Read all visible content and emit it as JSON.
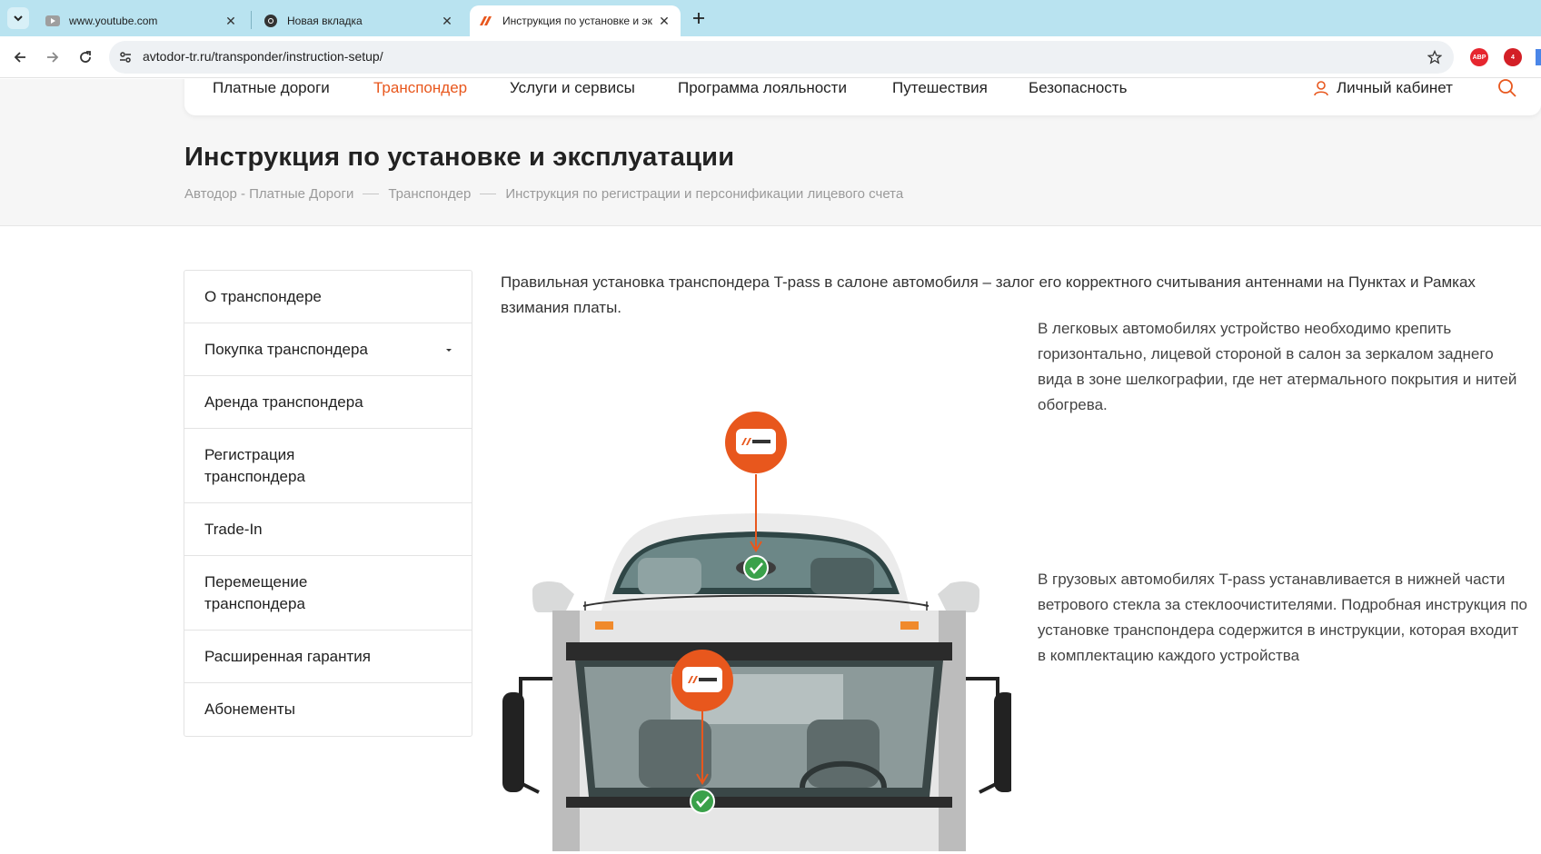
{
  "browser": {
    "tabs": [
      {
        "title": "www.youtube.com",
        "icon": "youtube-icon",
        "active": false
      },
      {
        "title": "Новая вкладка",
        "icon": "chrome-icon",
        "active": false
      },
      {
        "title": "Инструкция по установке и эк",
        "icon": "avtodor-logo-icon",
        "active": true
      }
    ],
    "url": "avtodor-tr.ru/transponder/instruction-setup/",
    "extensions": [
      {
        "name": "adblock-plus-icon",
        "label": "ABP",
        "color": "#e6262f"
      },
      {
        "name": "extension-badge-icon",
        "label": "4",
        "color": "#d31f26"
      }
    ]
  },
  "site": {
    "nav": [
      {
        "label": "Платные дороги",
        "active": false
      },
      {
        "label": "Транспондер",
        "active": true
      },
      {
        "label": "Услуги и сервисы",
        "active": false
      },
      {
        "label": "Программа лояльности",
        "active": false
      },
      {
        "label": "Путешествия",
        "active": false
      },
      {
        "label": "Безопасность",
        "active": false
      }
    ],
    "cabinet_label": "Личный кабинет",
    "accent_color": "#e8571d",
    "page_title": "Инструкция по установке и эксплуатации",
    "breadcrumbs": [
      "Автодор - Платные Дороги",
      "Транспондер",
      "Инструкция по регистрации и персонификации лицевого счета"
    ],
    "side_menu": [
      {
        "label": "О транспондере",
        "has_submenu": false
      },
      {
        "label": "Покупка транспондера",
        "has_submenu": true
      },
      {
        "label": "Аренда транспондера",
        "has_submenu": false
      },
      {
        "label": "Регистрация транспондера",
        "has_submenu": false
      },
      {
        "label": "Trade-In",
        "has_submenu": false
      },
      {
        "label": "Перемещение транспондера",
        "has_submenu": false
      },
      {
        "label": "Расширенная гарантия",
        "has_submenu": false
      },
      {
        "label": "Абонементы",
        "has_submenu": false
      }
    ],
    "intro": "Правильная установка транспондера T-pass в салоне автомобиля – залог его корректного считывания антеннами на Пунктах и Рамках взимания платы.",
    "car_text": "В легковых автомобилях устройство необходимо крепить горизонтально, лицевой стороной в салон за зеркалом заднего вида в зоне шелкографии, где нет атермального покрытия и нитей обогрева.",
    "truck_text": "В грузовых автомобилях T-pass устанавливается в нижней части ветрового стекла за стеклоочистителями. Подробная инструкция по установке транспондера содержится в инструкции, которая входит в комплектацию каждого устройства"
  }
}
